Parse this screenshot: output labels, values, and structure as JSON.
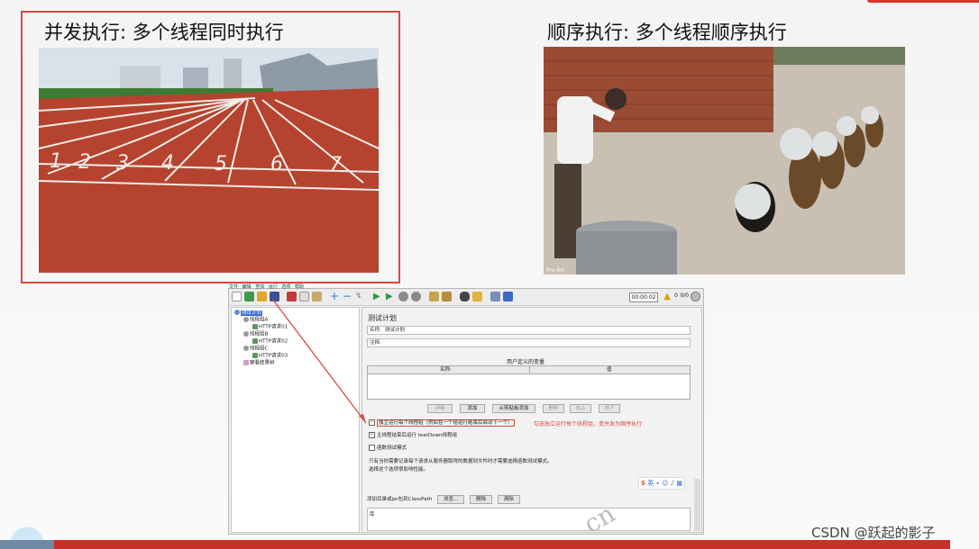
{
  "slide": {
    "left_heading": "并发执行: 多个线程同时执行",
    "right_heading": "顺序执行: 多个线程顺序执行",
    "watermark": "CSDN @跃起的影子",
    "watermark_fragment": "cn"
  },
  "track_image": {
    "lane_numbers": [
      "1",
      "2",
      "3",
      "4",
      "5",
      "6",
      "7"
    ],
    "colors": {
      "track": "#b5432f",
      "lines": "#f2ece6",
      "grass": "#3f7a35",
      "sky": "#d9e2ea"
    }
  },
  "dog_image": {
    "corner_text": "Pro Art",
    "colors": {
      "wall": "#9a4b34",
      "ground": "#c9c0b3",
      "coat": "#f2f2f2",
      "dog": "#6b4a2a"
    }
  },
  "jmeter": {
    "menu": [
      "文件",
      "编辑",
      "查找",
      "运行",
      "选项",
      "帮助"
    ],
    "timer": "00:00:02",
    "error_count": "0",
    "thread_count": "0/0",
    "tree": {
      "root": "测试计划",
      "items": [
        {
          "label": "线程组A"
        },
        {
          "label": "HTTP请求01"
        },
        {
          "label": "线程组B"
        },
        {
          "label": "HTTP请求02"
        },
        {
          "label": "线程组C"
        },
        {
          "label": "HTTP请求03"
        },
        {
          "label": "察看结果树"
        }
      ]
    },
    "panel": {
      "title": "测试计划",
      "name_label": "名称:",
      "name_value": "测试计划",
      "comment_label": "注释:",
      "comment_value": "",
      "uv_title": "用户定义的变量",
      "uv_col_name": "名称:",
      "uv_col_value": "值",
      "buttons": [
        "详细",
        "添加",
        "从剪贴板添加",
        "删除",
        "向上",
        "向下"
      ],
      "chk_serialize": "独立运行每个线程组（例如在一个组运行结束后启动下一个）",
      "chk_serialize_checked": true,
      "chk_teardown": "主线程结束后运行 tearDown线程组",
      "chk_teardown_checked": true,
      "chk_functional": "函数测试模式",
      "chk_functional_checked": false,
      "note": "勾选独立运行每个线程组，变并发为顺序执行",
      "desc_line1": "只有当你需要记录每个请求从服务器取得的数据到文件时才需要选择函数测试模式。",
      "desc_line2": "选择这个选项很影响性能。",
      "classpath_label": "添加目录或jar包到ClassPath",
      "classpath_buttons": [
        "浏览...",
        "删除",
        "清除"
      ],
      "classpath_list_header": "库",
      "ime_text": "英"
    }
  }
}
